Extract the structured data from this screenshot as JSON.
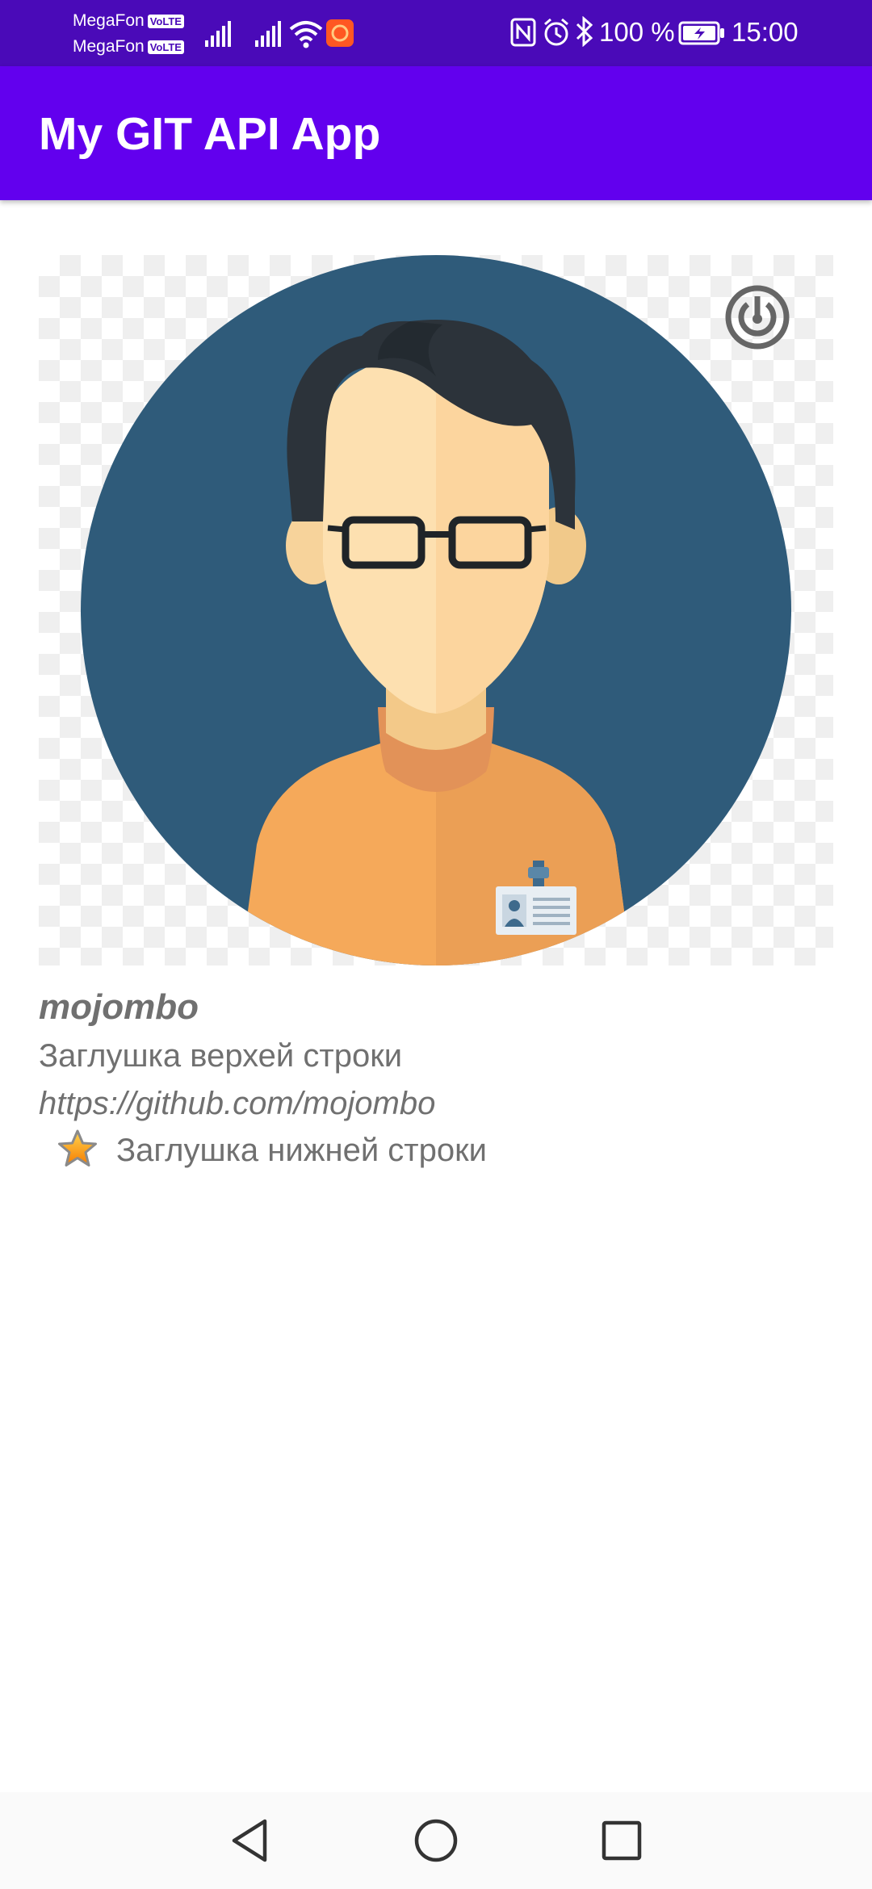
{
  "status_bar": {
    "carriers": [
      {
        "name": "MegaFon",
        "badge": "VoLTE"
      },
      {
        "name": "MegaFon",
        "badge": "VoLTE"
      }
    ],
    "battery_text": "100 %",
    "time": "15:00",
    "icons": [
      "signal-icon",
      "signal-icon",
      "wifi-icon",
      "notification-app-icon",
      "nfc-icon",
      "alarm-icon",
      "bluetooth-icon",
      "battery-charging-icon"
    ]
  },
  "app_bar": {
    "title": "My GIT API App"
  },
  "user": {
    "login": "mojombo",
    "top_line": "Заглушка верхей строки",
    "url": "https://github.com/mojombo",
    "bottom_line": "Заглушка нижней строки",
    "avatar_icon": "user-avatar-illustration",
    "avatar_overlay_icon": "refresh-icon",
    "bottom_line_icon": "star-icon"
  },
  "nav_bar": {
    "buttons": [
      "back-icon",
      "home-icon",
      "recents-icon"
    ]
  },
  "colors": {
    "status_bar": "#4a0ab8",
    "app_bar": "#6200ee",
    "text": "#707070",
    "avatar_bg": "#2f5b7a",
    "shirt": "#f5a95a",
    "hair": "#2c333a",
    "skin": "#fde0b0"
  }
}
